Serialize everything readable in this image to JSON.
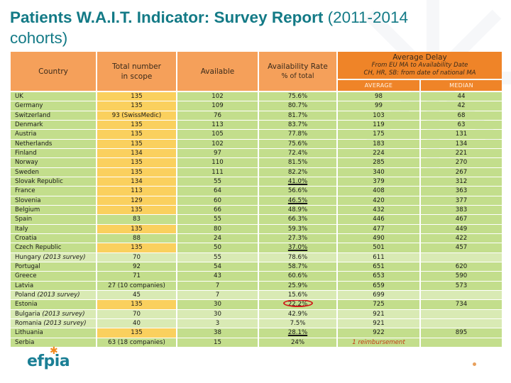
{
  "title": {
    "bold": "Patients W.A.I.T. Indicator: Survey Report",
    "normal": " (2011-2014 cohorts)"
  },
  "colors": {
    "title": "#137a86",
    "header": "#f5a05a",
    "header_dark": "#ef8428",
    "row_dark": "#c3de8c",
    "row_light": "#d9eab4",
    "highlight_yellow": "#fad05e",
    "circle": "#d0181a"
  },
  "headers": {
    "country": "Country",
    "total_line1": "Total number",
    "total_line2": "in scope",
    "available": "Available",
    "rate": "Availability Rate",
    "rate_sub": "% of total",
    "delay": "Average Delay",
    "delay_sub1": "From EU MA to Availability Date",
    "delay_sub2": "CH, HR, SB: from date of national MA",
    "average": "AVERAGE",
    "median": "MEDIAN"
  },
  "rows": [
    {
      "country": "UK",
      "note": "",
      "total": "135",
      "total_hl": true,
      "available": "102",
      "rate": "75.6%",
      "rate_ul": false,
      "average": "98",
      "median": "44",
      "light": false
    },
    {
      "country": "Germany",
      "note": "",
      "total": "135",
      "total_hl": true,
      "available": "109",
      "rate": "80.7%",
      "rate_ul": false,
      "average": "99",
      "median": "42",
      "light": false
    },
    {
      "country": "Switzerland",
      "note": "",
      "total": "93 (SwissMedic)",
      "total_hl": true,
      "available": "76",
      "rate": "81.7%",
      "rate_ul": false,
      "average": "103",
      "median": "68",
      "light": false
    },
    {
      "country": "Denmark",
      "note": "",
      "total": "135",
      "total_hl": true,
      "available": "113",
      "rate": "83.7%",
      "rate_ul": false,
      "average": "119",
      "median": "63",
      "light": false
    },
    {
      "country": "Austria",
      "note": "",
      "total": "135",
      "total_hl": true,
      "available": "105",
      "rate": "77.8%",
      "rate_ul": false,
      "average": "175",
      "median": "131",
      "light": false
    },
    {
      "country": "Netherlands",
      "note": "",
      "total": "135",
      "total_hl": true,
      "available": "102",
      "rate": "75.6%",
      "rate_ul": false,
      "average": "183",
      "median": "134",
      "light": false
    },
    {
      "country": "Finland",
      "note": "",
      "total": "134",
      "total_hl": true,
      "available": "97",
      "rate": "72.4%",
      "rate_ul": false,
      "average": "224",
      "median": "221",
      "light": false
    },
    {
      "country": "Norway",
      "note": "",
      "total": "135",
      "total_hl": true,
      "available": "110",
      "rate": "81.5%",
      "rate_ul": false,
      "average": "285",
      "median": "270",
      "light": false
    },
    {
      "country": "Sweden",
      "note": "",
      "total": "135",
      "total_hl": true,
      "available": "111",
      "rate": "82.2%",
      "rate_ul": false,
      "average": "340",
      "median": "267",
      "light": false
    },
    {
      "country": "Slovak Republic",
      "note": "",
      "total": "134",
      "total_hl": true,
      "available": "55",
      "rate": "41.0%",
      "rate_ul": true,
      "average": "379",
      "median": "312",
      "light": false
    },
    {
      "country": "France",
      "note": "",
      "total": "113",
      "total_hl": true,
      "available": "64",
      "rate": "56.6%",
      "rate_ul": false,
      "average": "408",
      "median": "363",
      "light": false
    },
    {
      "country": "Slovenia",
      "note": "",
      "total": "129",
      "total_hl": true,
      "available": "60",
      "rate": "46.5%",
      "rate_ul": true,
      "average": "420",
      "median": "377",
      "light": false
    },
    {
      "country": "Belgium",
      "note": "",
      "total": "135",
      "total_hl": true,
      "available": "66",
      "rate": "48.9%",
      "rate_ul": false,
      "average": "432",
      "median": "383",
      "light": false
    },
    {
      "country": "Spain",
      "note": "",
      "total": "83",
      "total_hl": false,
      "available": "55",
      "rate": "66.3%",
      "rate_ul": false,
      "average": "446",
      "median": "467",
      "light": false
    },
    {
      "country": "Italy",
      "note": "",
      "total": "135",
      "total_hl": true,
      "available": "80",
      "rate": "59.3%",
      "rate_ul": false,
      "average": "477",
      "median": "449",
      "light": false
    },
    {
      "country": "Croatia",
      "note": "",
      "total": "88",
      "total_hl": false,
      "available": "24",
      "rate": "27.3%",
      "rate_ul": false,
      "average": "490",
      "median": "422",
      "light": false
    },
    {
      "country": "Czech Republic",
      "note": "",
      "total": "135",
      "total_hl": true,
      "available": "50",
      "rate": "37.0%",
      "rate_ul": true,
      "average": "501",
      "median": "457",
      "light": false
    },
    {
      "country": "Hungary",
      "note": "(2013 survey)",
      "total": "70",
      "total_hl": false,
      "available": "55",
      "rate": "78.6%",
      "rate_ul": false,
      "average": "611",
      "median": "",
      "light": true
    },
    {
      "country": "Portugal",
      "note": "",
      "total": "92",
      "total_hl": false,
      "available": "54",
      "rate": "58.7%",
      "rate_ul": false,
      "average": "651",
      "median": "620",
      "light": false
    },
    {
      "country": "Greece",
      "note": "",
      "total": "71",
      "total_hl": false,
      "available": "43",
      "rate": "60.6%",
      "rate_ul": false,
      "average": "653",
      "median": "590",
      "light": false
    },
    {
      "country": "Latvia",
      "note": "",
      "total": "27 (10 companies)",
      "total_hl": false,
      "available": "7",
      "rate": "25.9%",
      "rate_ul": false,
      "average": "659",
      "median": "573",
      "light": false
    },
    {
      "country": "Poland",
      "note": "(2013 survey)",
      "total": "45",
      "total_hl": false,
      "available": "7",
      "rate": "15.6%",
      "rate_ul": false,
      "average": "699",
      "median": "",
      "light": true
    },
    {
      "country": "Estonia",
      "note": "",
      "total": "135",
      "total_hl": true,
      "available": "30",
      "rate": "22.2%",
      "rate_ul": false,
      "rate_circled": true,
      "average": "725",
      "median": "734",
      "light": false
    },
    {
      "country": "Bulgaria",
      "note": "(2013 survey)",
      "total": "70",
      "total_hl": false,
      "available": "30",
      "rate": "42.9%",
      "rate_ul": false,
      "average": "921",
      "median": "",
      "light": true
    },
    {
      "country": "Romania",
      "note": "(2013 survey)",
      "total": "40",
      "total_hl": false,
      "available": "3",
      "rate": "7.5%",
      "rate_ul": false,
      "average": "921",
      "median": "",
      "light": true
    },
    {
      "country": "Lithuania",
      "note": "",
      "total": "135",
      "total_hl": true,
      "available": "38",
      "rate": "28.1%",
      "rate_ul": true,
      "average": "922",
      "median": "895",
      "light": false
    },
    {
      "country": "Serbia",
      "note": "",
      "total": "63 (18 companies)",
      "total_hl": false,
      "available": "15",
      "rate": "24%",
      "rate_ul": false,
      "average": "1 reimbursement",
      "average_note": true,
      "median": "",
      "light": false
    }
  ],
  "footer": {
    "logo_text": "efpia",
    "logo_star": "✱"
  }
}
